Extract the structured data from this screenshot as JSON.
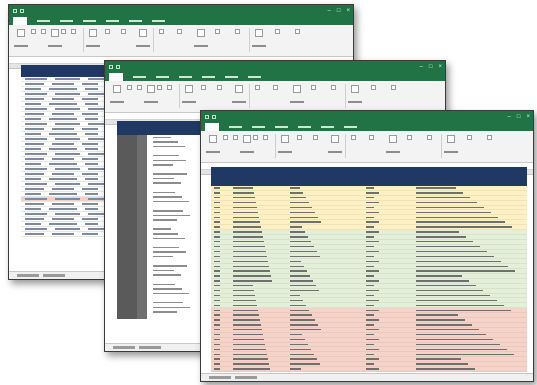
{
  "colors": {
    "excel_green": "#217346",
    "header_navy": "#1f3864",
    "band_yellow": "#fdf0c4",
    "band_green": "#e3efd9",
    "band_pink": "#f6d3c8"
  },
  "icons": [
    "quick-access-save-icon",
    "minimize-icon",
    "maximize-icon",
    "close-icon"
  ],
  "windows": [
    {
      "id": "w1",
      "rows": 32
    },
    {
      "id": "w2",
      "rows": 40
    },
    {
      "id": "w3",
      "bands": [
        {
          "band": "yellow",
          "rows": 9
        },
        {
          "band": "green",
          "rows": 16
        },
        {
          "band": "pink",
          "rows": 13
        },
        {
          "band": "white",
          "rows": 2
        }
      ]
    }
  ]
}
